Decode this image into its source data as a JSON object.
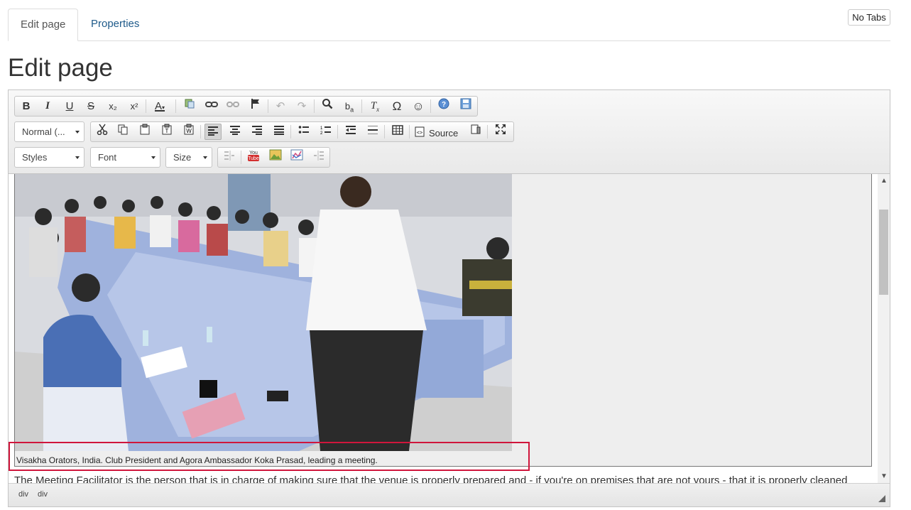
{
  "tabs": {
    "edit": "Edit page",
    "properties": "Properties",
    "no_tabs": "No Tabs"
  },
  "page_title": "Edit page",
  "toolbar": {
    "format_combo": "Normal (...",
    "styles_combo": "Styles",
    "font_combo": "Font",
    "size_combo": "Size",
    "source_label": "Source",
    "icons_row1": [
      "bold-icon",
      "italic-icon",
      "underline-icon",
      "strike-icon",
      "subscript-icon",
      "superscript-icon",
      "text-color-icon",
      "paste-from-word-icon",
      "link-icon",
      "unlink-icon",
      "anchor-icon",
      "undo-icon",
      "redo-icon",
      "find-icon",
      "replace-icon",
      "remove-format-icon",
      "special-char-icon",
      "smiley-icon",
      "help-icon",
      "save-icon"
    ],
    "glyphs": {
      "bold": "B",
      "italic": "I",
      "underline": "U",
      "strike": "S",
      "subscript": "x₂",
      "superscript": "x²",
      "textcolor": "A",
      "omega": "Ω",
      "smiley": "☺",
      "help": "?",
      "find": "🔍",
      "replace": "b̶a",
      "removeformat": "Tx"
    }
  },
  "content": {
    "caption": "Visakha Orators, India. Club President and Agora Ambassador Koka Prasad, leading a meeting.",
    "body": "The Meeting Facilitator is the person that is in charge of making sure that the venue is properly prepared and - if you're on premises that are not yours - that it is properly cleaned"
  },
  "statusbar": {
    "path1": "div",
    "path2": "div"
  },
  "colors": {
    "highlight": "#d0163c",
    "link": "#1e5a8a"
  }
}
